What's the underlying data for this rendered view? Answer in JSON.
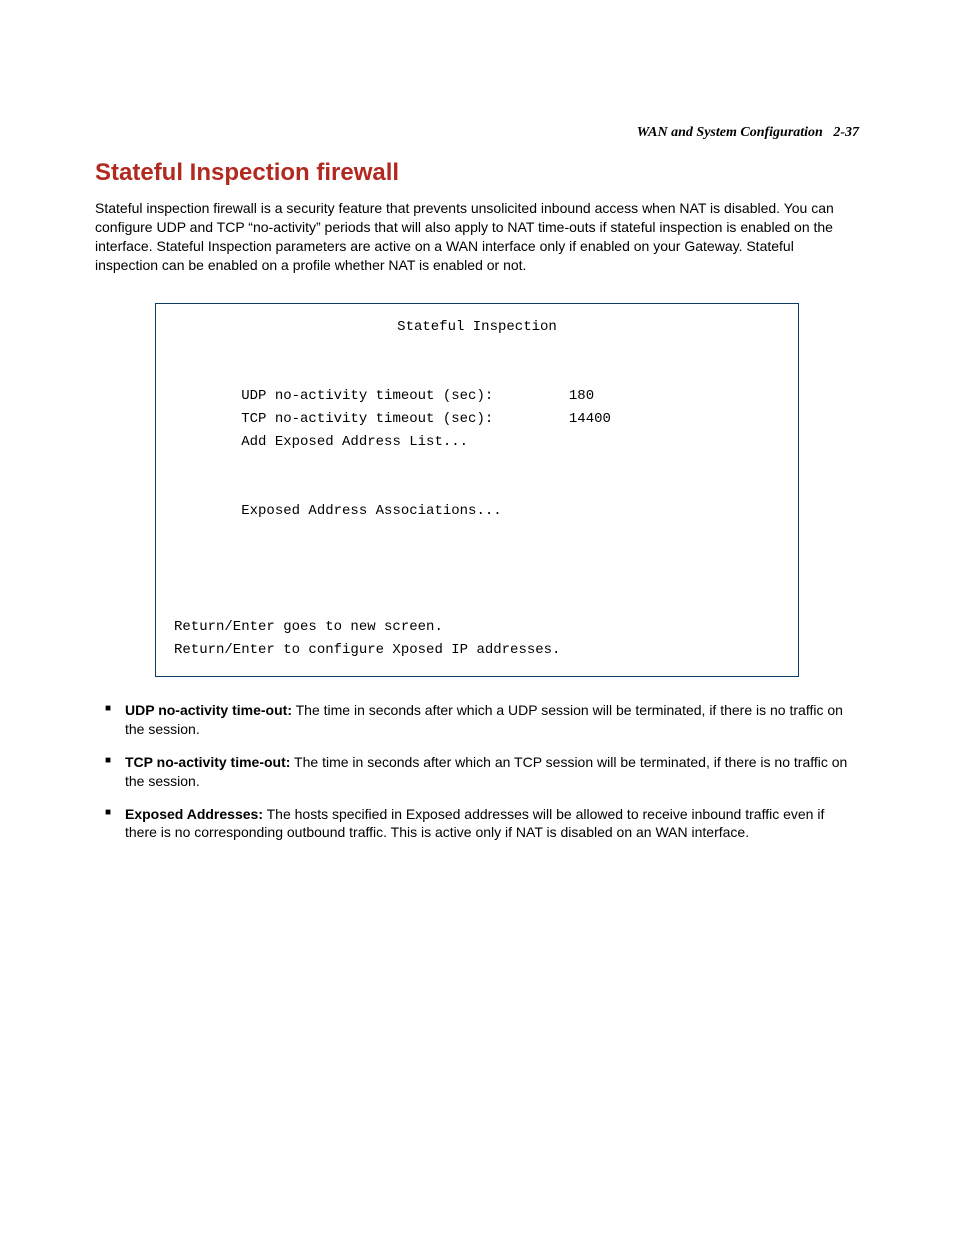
{
  "header": {
    "section": "WAN and System Configuration",
    "page_num": "2-37"
  },
  "title": "Stateful Inspection firewall",
  "intro": "Stateful inspection firewall is a security feature that prevents unsolicited inbound access when NAT is disabled. You can configure UDP and TCP “no-activity” periods that will also apply to NAT time-outs if stateful inspection is enabled on the interface. Stateful Inspection parameters are active on a WAN interface only if enabled on your Gateway. Stateful inspection can be enabled on a profile whether NAT is enabled or not.",
  "terminal": {
    "title": "Stateful Inspection",
    "rows": [
      {
        "label": "UDP no-activity timeout (sec):",
        "value": "180"
      },
      {
        "label": "TCP no-activity timeout (sec):",
        "value": "14400"
      },
      {
        "label": "Add Exposed Address List...",
        "value": ""
      },
      {
        "label": "",
        "value": ""
      },
      {
        "label": "Exposed Address Associations...",
        "value": ""
      }
    ],
    "footer1": "Return/Enter goes to new screen.",
    "footer2": "Return/Enter to configure Xposed IP addresses."
  },
  "bullets": [
    {
      "term": "UDP no-activity time-out:",
      "desc": " The time in seconds after which a UDP session will be terminated, if there is no traffic on the session."
    },
    {
      "term": "TCP no-activity time-out:",
      "desc": " The time in seconds after which an TCP session will be terminated, if there is no traffic on the session."
    },
    {
      "term": "Exposed Addresses:",
      "desc": " The hosts specified in Exposed addresses will be allowed to receive inbound traffic even if there is no corresponding outbound traffic. This is active only if NAT is disabled on an WAN interface."
    }
  ]
}
